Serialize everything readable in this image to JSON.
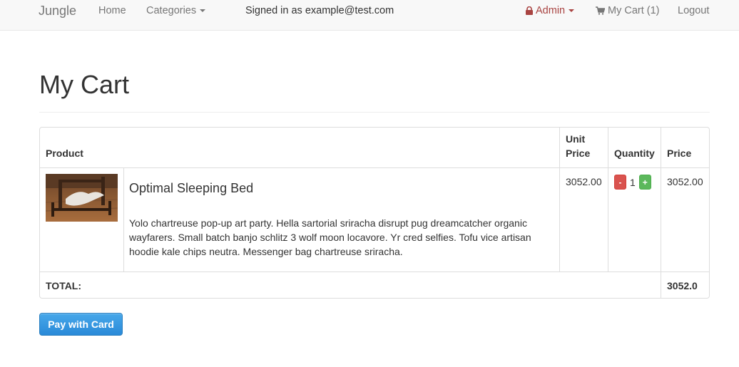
{
  "nav": {
    "brand": "Jungle",
    "home": "Home",
    "categories": "Categories",
    "signed_in": "Signed in as example@test.com",
    "admin": "Admin",
    "cart": "My Cart (1)",
    "logout": "Logout"
  },
  "page": {
    "title": "My Cart"
  },
  "table": {
    "headers": {
      "product": "Product",
      "unit_price": "Unit Price",
      "quantity": "Quantity",
      "price": "Price"
    },
    "items": [
      {
        "name": "Optimal Sleeping Bed",
        "description": "Yolo chartreuse pop-up art party. Hella sartorial sriracha disrupt pug dreamcatcher organic wayfarers. Small batch banjo schlitz 3 wolf moon locavore. Yr cred selfies. Tofu vice artisan hoodie kale chips neutra. Messenger bag chartreuse sriracha.",
        "unit_price": "3052.00",
        "quantity": "1",
        "minus": "-",
        "plus": "+",
        "price": "3052.00"
      }
    ],
    "total_label": "TOTAL:",
    "total_value": "3052.0"
  },
  "actions": {
    "pay": "Pay with Card"
  },
  "colors": {
    "admin": "#a94442",
    "pay_button": "#3498db",
    "decrease": "#d9534f",
    "increase": "#5cb85c"
  }
}
